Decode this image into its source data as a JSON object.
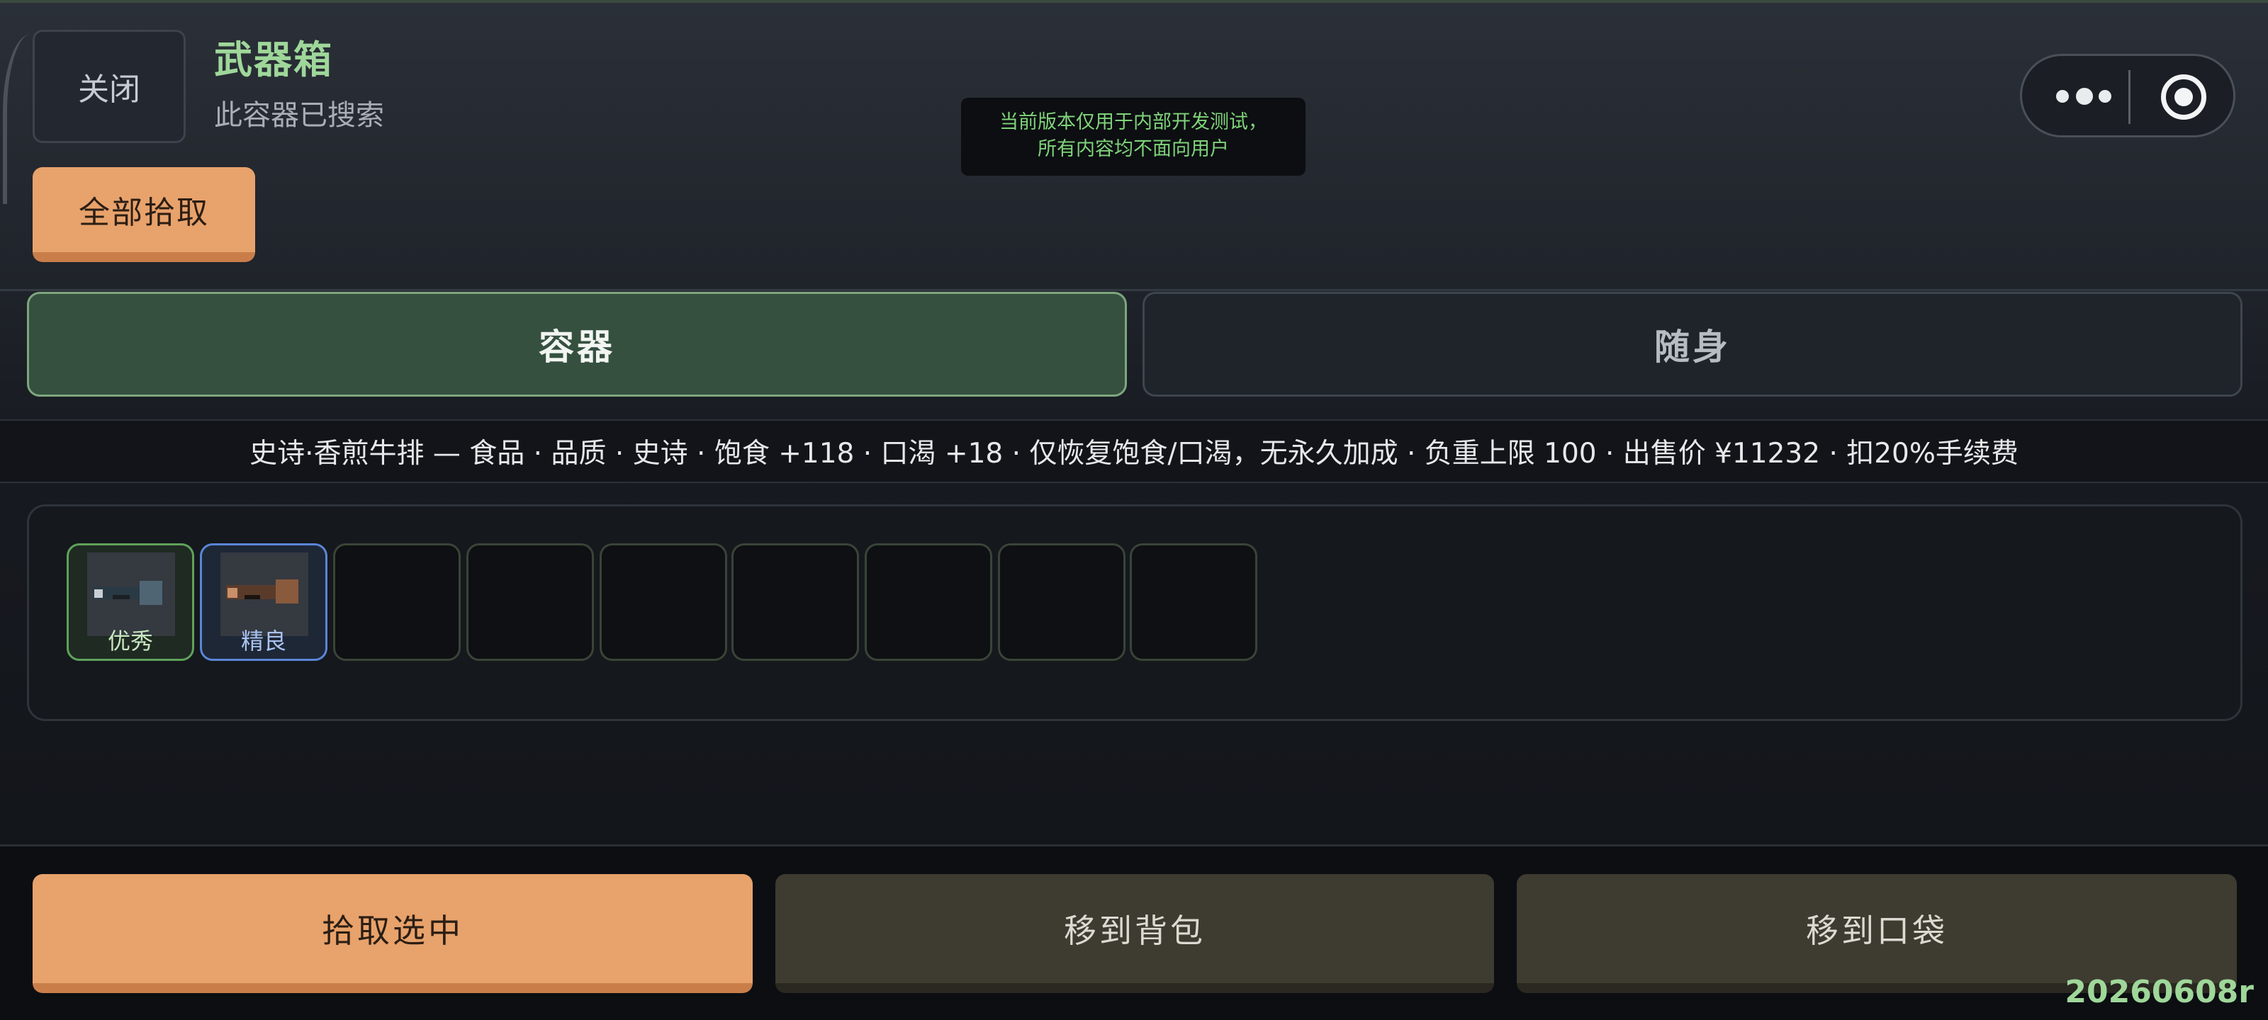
{
  "header": {
    "close_label": "关闭",
    "title": "武器箱",
    "subtitle": "此容器已搜索",
    "take_all_label": "全部拾取"
  },
  "toast": {
    "line1": "当前版本仅用于内部开发测试，",
    "line2": "所有内容均不面向用户"
  },
  "capsule": {
    "more_icon": "more-dots-icon",
    "close_icon": "target-icon"
  },
  "tabs": [
    {
      "label": "容器",
      "active": true
    },
    {
      "label": "随身",
      "active": false
    }
  ],
  "info_bar": {
    "text": "史诗·香煎牛排 — 食品 · 品质 · 史诗 · 饱食 +118 · 口渴 +18 · 仅恢复饱食/口渴，无永久加成 · 负重上限 100 · 出售价 ¥11232 · 扣20%手续费"
  },
  "slots": [
    {
      "rarity": "优秀",
      "rarity_color": "#5fa25a"
    },
    {
      "rarity": "精良",
      "rarity_color": "#5a86d6"
    },
    {
      "rarity": ""
    },
    {
      "rarity": ""
    },
    {
      "rarity": ""
    },
    {
      "rarity": ""
    },
    {
      "rarity": ""
    },
    {
      "rarity": ""
    },
    {
      "rarity": ""
    }
  ],
  "actions": {
    "pick_selected": "拾取选中",
    "move_to_backpack": "移到背包",
    "move_to_pocket": "移到口袋"
  },
  "version": "20260608r",
  "colors": {
    "accent_green": "#9fd79a",
    "accent_orange": "#e8a26b",
    "tab_active_bg": "#35503f"
  }
}
